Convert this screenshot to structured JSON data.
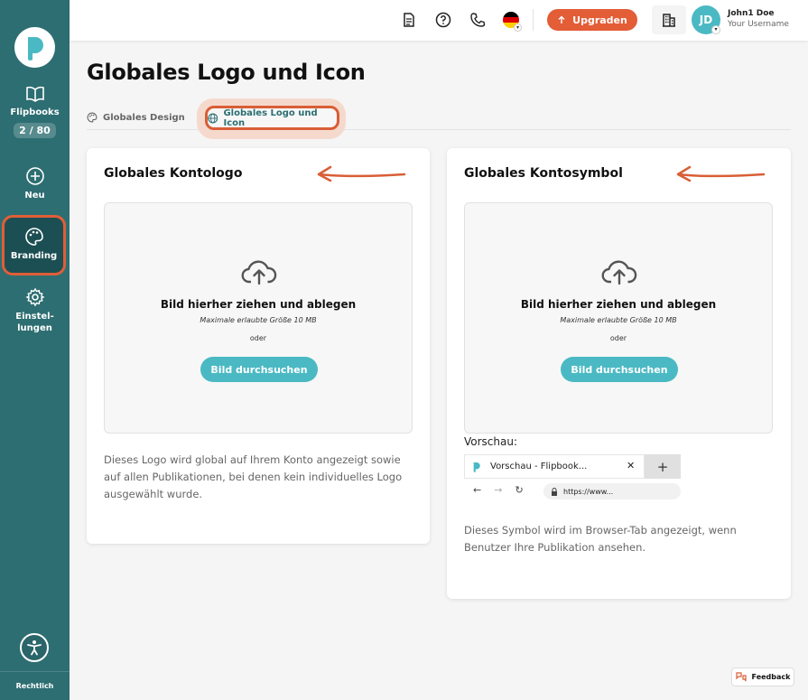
{
  "sidebar": {
    "items": [
      {
        "label": "Flipbooks",
        "badge": "2 / 80"
      },
      {
        "label": "Neu"
      },
      {
        "label": "Branding"
      },
      {
        "label": "Einstel-\nlungen"
      }
    ],
    "legal": "Rechtlich"
  },
  "header": {
    "upgrade_label": "Upgraden",
    "avatar_initials": "JD",
    "user_name": "John1 Doe",
    "user_username": "Your Username",
    "language": "de"
  },
  "page": {
    "title": "Globales Logo und Icon",
    "tabs": [
      {
        "label": "Globales Design",
        "active": false
      },
      {
        "label": "Globales Logo und Icon",
        "active": true
      }
    ]
  },
  "cards": {
    "logo": {
      "title": "Globales Kontologo",
      "dropzone": {
        "title": "Bild hierher ziehen und ablegen",
        "subtitle": "Maximale erlaubte Größe 10 MB",
        "or": "oder",
        "button": "Bild durchsuchen"
      },
      "description": "Dieses Logo wird global auf Ihrem Konto angezeigt sowie auf allen Publikationen, bei denen kein individuelles Logo ausgewählt wurde."
    },
    "icon": {
      "title": "Globales Kontosymbol",
      "dropzone": {
        "title": "Bild hierher ziehen und ablegen",
        "subtitle": "Maximale erlaubte Größe 10 MB",
        "or": "oder",
        "button": "Bild durchsuchen"
      },
      "preview_label": "Vorschau:",
      "browser": {
        "tab_title": "Vorschau - Flipbook...",
        "url": "https://www..."
      },
      "description": "Dieses Symbol wird im Browser-Tab angezeigt, wenn Benutzer Ihre Publikation ansehen."
    }
  },
  "feedback_label": "Feedback",
  "colors": {
    "sidebar": "#2d6e72",
    "accent": "#4ab9c3",
    "upgrade": "#e35d37",
    "annotation": "#d95e36"
  }
}
